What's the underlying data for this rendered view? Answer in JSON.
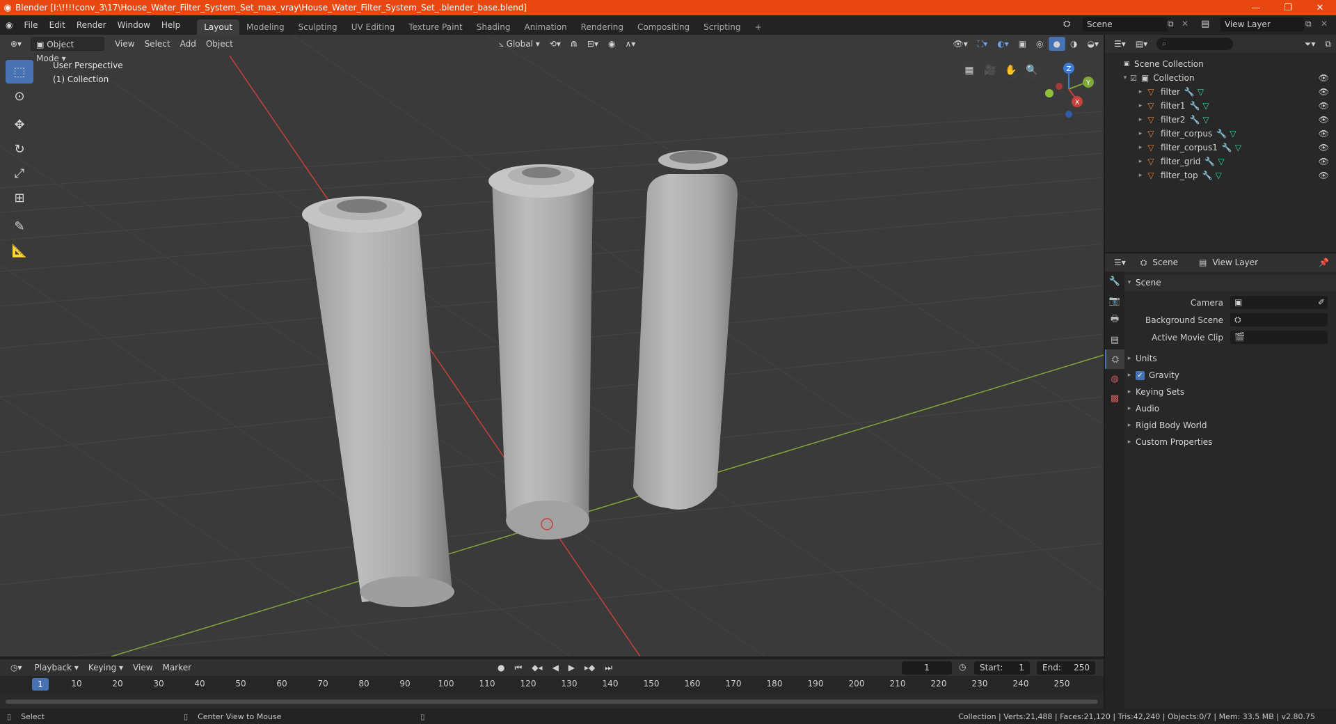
{
  "window": {
    "title": "Blender [I:\\!!!!conv_3\\17\\House_Water_Filter_System_Set_max_vray\\House_Water_Filter_System_Set_.blender_base.blend]"
  },
  "menu": [
    "File",
    "Edit",
    "Render",
    "Window",
    "Help"
  ],
  "workspaces": [
    "Layout",
    "Modeling",
    "Sculpting",
    "UV Editing",
    "Texture Paint",
    "Shading",
    "Animation",
    "Rendering",
    "Compositing",
    "Scripting"
  ],
  "active_workspace": "Layout",
  "scene_name": "Scene",
  "view_layer_name": "View Layer",
  "viewport": {
    "mode": "Object Mode",
    "menus": [
      "View",
      "Select",
      "Add",
      "Object"
    ],
    "orientation": "Global",
    "info_line1": "User Perspective",
    "info_line2": "(1) Collection",
    "gizmo": {
      "x": "X",
      "y": "Y",
      "z": "Z"
    }
  },
  "outliner": {
    "root": "Scene Collection",
    "collection": "Collection",
    "objects": [
      "filter",
      "filter1",
      "filter2",
      "filter_corpus",
      "filter_corpus1",
      "filter_grid",
      "filter_top"
    ]
  },
  "properties": {
    "scene_tab": "Scene",
    "view_layer_tab": "View Layer",
    "panel_title": "Scene",
    "camera_label": "Camera",
    "background_scene_label": "Background Scene",
    "active_movie_clip_label": "Active Movie Clip",
    "subpanels": [
      "Units",
      "Gravity",
      "Keying Sets",
      "Audio",
      "Rigid Body World",
      "Custom Properties"
    ],
    "gravity_checked": true
  },
  "timeline": {
    "menus": [
      "Playback",
      "Keying",
      "View",
      "Marker"
    ],
    "current_frame": "1",
    "start_label": "Start:",
    "start_value": "1",
    "end_label": "End:",
    "end_value": "250",
    "ticks": [
      "1",
      "10",
      "20",
      "30",
      "40",
      "50",
      "60",
      "70",
      "80",
      "90",
      "100",
      "110",
      "120",
      "130",
      "140",
      "150",
      "160",
      "170",
      "180",
      "190",
      "200",
      "210",
      "220",
      "230",
      "240",
      "250"
    ]
  },
  "status": {
    "select": "Select",
    "center_view": "Center View to Mouse",
    "stats": "Collection | Verts:21,488 | Faces:21,120 | Tris:42,240 | Objects:0/7 | Mem: 33.5 MB | v2.80.75"
  },
  "colors": {
    "accent": "#4772b3",
    "titlebar": "#e8480f",
    "object_icon": "#e8883a",
    "mesh_icon": "#3ecfa8",
    "x_axis": "#c8403a",
    "y_axis": "#7fa83a"
  }
}
